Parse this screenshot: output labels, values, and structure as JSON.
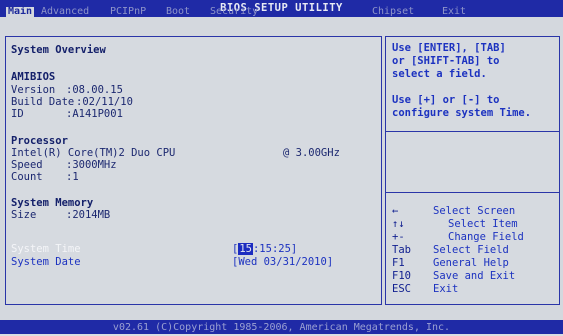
{
  "header": {
    "title": "BIOS SETUP UTILITY",
    "tabs": [
      {
        "label": "Main",
        "active": true
      },
      {
        "label": "Advanced",
        "active": false
      },
      {
        "label": "PCIPnP",
        "active": false
      },
      {
        "label": "Boot",
        "active": false
      },
      {
        "label": "Security",
        "active": false
      },
      {
        "label": "Chipset",
        "active": false
      },
      {
        "label": "Exit",
        "active": false
      }
    ]
  },
  "overview": {
    "heading": "System Overview",
    "amibios": {
      "heading": "AMIBIOS",
      "version_label": "Version",
      "version_value": ":08.00.15",
      "build_label": "Build Date",
      "build_value": ":02/11/10",
      "id_label": "ID",
      "id_value": ":A141P001"
    },
    "processor": {
      "heading": "Processor",
      "cpu_name": "Intel(R) Core(TM)2 Duo CPU",
      "cpu_freq": "@ 3.00GHz",
      "speed_label": "Speed",
      "speed_value": ":3000MHz",
      "count_label": "Count",
      "count_value": ":1"
    },
    "memory": {
      "heading": "System Memory",
      "size_label": "Size",
      "size_value": ":2014MB"
    },
    "system_time": {
      "label": "System Time",
      "open_bracket": "[",
      "hour": "15",
      "rest": ":15:25]"
    },
    "system_date": {
      "label": "System Date",
      "value": "[Wed 03/31/2010]"
    }
  },
  "help": {
    "line1": "Use [ENTER], [TAB]",
    "line2": "or [SHIFT-TAB] to",
    "line3": "select a field.",
    "line4": "Use [+] or [-] to",
    "line5": "configure system Time."
  },
  "keys": [
    {
      "key": "←",
      "desc": "Select Screen"
    },
    {
      "key": "↑↓",
      "desc": "Select Item"
    },
    {
      "key": "+-",
      "desc": "Change Field"
    },
    {
      "key": "Tab",
      "desc": "Select Field"
    },
    {
      "key": "F1",
      "desc": "General Help"
    },
    {
      "key": "F10",
      "desc": "Save and Exit"
    },
    {
      "key": "ESC",
      "desc": "Exit"
    }
  ],
  "footer": {
    "text": "v02.61 (C)Copyright 1985-2006, American Megatrends, Inc."
  },
  "colors": {
    "bar_blue": "#1f2aa6",
    "panel_bg": "#d6dae0",
    "help_text": "#1c32c0",
    "highlight": "#f4f5f8"
  }
}
